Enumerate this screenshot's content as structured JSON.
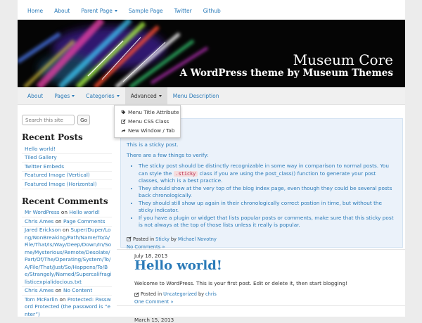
{
  "top_nav": [
    "Home",
    "About",
    "Parent Page",
    "Sample Page",
    "Twitter",
    "Github"
  ],
  "site": {
    "title": "Museum Core",
    "description": "A WordPress theme by Museum Themes"
  },
  "main_nav": [
    "About",
    "Pages",
    "Categories",
    "Advanced",
    "Menu Description"
  ],
  "dropdown": [
    "Menu Title Attribute",
    "Menu CSS Class",
    "New Window / Tab"
  ],
  "search": {
    "placeholder": "Search this site",
    "button": "Go"
  },
  "recent_posts": {
    "title": "Recent Posts",
    "items": [
      "Hello world!",
      "Tiled Gallery",
      "Twitter Embeds",
      "Featured Image (Vertical)",
      "Featured Image (Horizontal)"
    ]
  },
  "recent_comments": {
    "title": "Recent Comments",
    "items": [
      {
        "author": "Mr WordPress",
        "on": "on",
        "post": "Hello world!"
      },
      {
        "author": "Chris Ames",
        "on": "on",
        "post": "Page Comments"
      },
      {
        "author": "Jared Erickson",
        "on": "on",
        "post": "Super/Duper/Long/NonBreaking/Path/Name/To/A/File/That/Is/Way/Deep/Down/In/Some/Mysterious/Remote/Desolate/Part/Of/The/Operating/System/To/A/File/That/Just/So/Happens/To/Be/Strangely/Named/Supercalifragilisticexpialidocious.txt"
      },
      {
        "author": "Chris Ames",
        "on": "on",
        "post": "No Content"
      },
      {
        "author": "Tom McFarlin",
        "on": "on",
        "post": "Protected: Password Protected (the password is “enter”)"
      }
    ]
  },
  "sticky_post": {
    "title": "Sticky",
    "intro": "This is a sticky post.",
    "lead": "There are a few things to verify:",
    "bullets": [
      {
        "before": "The sticky post should be distinctly recognizable in some way in comparison to normal posts. You can style the ",
        "code": ".sticky",
        "after": " class if you are using the post_class() function to generate your post classes, which is a best practice."
      },
      {
        "before": "They should show at the very top of the blog index page, even though they could be several posts back chronologically."
      },
      {
        "before": "They should still show up again in their chronologically correct postion in time, but without the sticky indicator."
      },
      {
        "before": "If you have a plugin or widget that lists popular posts or comments, make sure that this sticky post is not always at the top of those lists unless it really is popular."
      }
    ],
    "meta_posted": "Posted in",
    "meta_category": "Sticky",
    "meta_by": "by",
    "meta_author": "Michael Novotny",
    "comments": "No Comments »"
  },
  "post": {
    "date": "July 18, 2013",
    "title": "Hello world!",
    "body": "Welcome to WordPress. This is your first post. Edit or delete it, then start blogging!",
    "meta_posted": "Posted in",
    "meta_category": "Uncategorized",
    "meta_by": "by",
    "meta_author": "chris",
    "comments": "One Comment »"
  },
  "next_post_date": "March 15, 2013",
  "colors": {
    "link": "#2a7ab8",
    "sticky_bg": "#ebf2fa"
  }
}
